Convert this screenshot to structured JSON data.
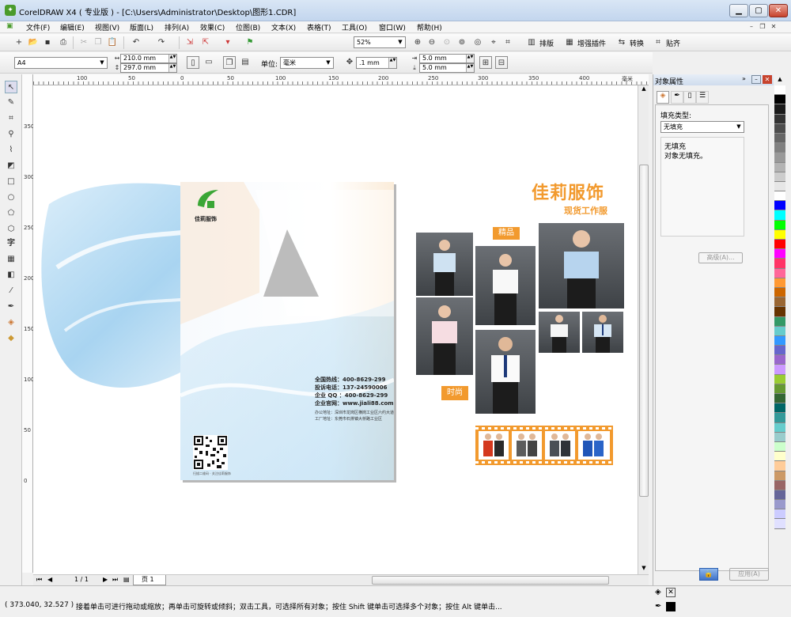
{
  "window": {
    "title": "CorelDRAW X4 ( 专业版 ) - [C:\\Users\\Administrator\\Desktop\\图形1.CDR]"
  },
  "menu": [
    "文件(F)",
    "编辑(E)",
    "视图(V)",
    "版面(L)",
    "排列(A)",
    "效果(C)",
    "位图(B)",
    "文本(X)",
    "表格(T)",
    "工具(O)",
    "窗口(W)",
    "帮助(H)"
  ],
  "toolbar": {
    "zoom": "52%",
    "layout_label": "排版",
    "plugin_label": "增强插件",
    "convert_label": "转换",
    "snap_label": "贴齐"
  },
  "propbar": {
    "page_size": "A4",
    "width": "210.0 mm",
    "height": "297.0 mm",
    "unit_label": "单位:",
    "unit": "毫米",
    "nudge": ".1 mm",
    "dup_x": "5.0 mm",
    "dup_y": "5.0 mm"
  },
  "rulers": {
    "h": [
      "100",
      "50",
      "0",
      "50",
      "100",
      "150",
      "200",
      "250",
      "300",
      "350",
      "400"
    ],
    "h_unit": "毫米",
    "v": [
      "350",
      "300",
      "250",
      "200",
      "150",
      "100",
      "50",
      "0"
    ]
  },
  "panel": {
    "title": "对象属性",
    "fill_type_label": "填充类型:",
    "fill_type": "无填充",
    "info_title": "无填充",
    "info_desc": "对象无填充。",
    "advanced": "高级(A)...",
    "apply": "应用(A)"
  },
  "page_nav": {
    "count": "1 / 1",
    "tab": "页 1"
  },
  "status": {
    "coords": "( 373.040, 32.527 )",
    "hint": "接着单击可进行拖动或缩放；再单击可旋转或倾斜；双击工具，可选择所有对象；按住 Shift 键单击可选择多个对象；按住 Alt 键单击..."
  },
  "design": {
    "brand_cn": "佳莉服饰",
    "subtitle": "现货工作服",
    "tag_jingpin": "精品",
    "tag_shishang": "时尚",
    "logo_text": "佳莉服饰",
    "contact": [
      "全国热线：400-8629-299",
      "投诉电话：137-24590006",
      "企业 QQ ：400-8629-299",
      "企业官网：www.jiali88.com"
    ],
    "addr": [
      "办公地址：深圳市龙岗区横岗工业区六约大道",
      "工厂地址：东莞市石排镇大桥路工业区"
    ],
    "qr_caption": "扫描二维码 · 关注佳莉服饰"
  },
  "palette": [
    "#ffffff",
    "#000000",
    "#1a1a1a",
    "#333333",
    "#4d4d4d",
    "#666666",
    "#808080",
    "#999999",
    "#b3b3b3",
    "#cccccc",
    "#e6e6e6",
    "#ffffff",
    "#0000ff",
    "#00ffff",
    "#00ff00",
    "#ffff00",
    "#ff0000",
    "#ff00ff",
    "#ff3366",
    "#ff6699",
    "#ff9933",
    "#cc6600",
    "#996633",
    "#663300",
    "#339966",
    "#66cccc",
    "#3399ff",
    "#6666cc",
    "#9966cc",
    "#cc99ff",
    "#99cc33",
    "#669933",
    "#336633",
    "#006666",
    "#339999",
    "#66cccc",
    "#99cccc",
    "#ccffcc",
    "#ffffcc",
    "#ffcc99",
    "#cc9966",
    "#996666",
    "#666699",
    "#9999cc",
    "#ccccff",
    "#e0e0ff"
  ],
  "colors": {
    "accent": "#f29a2e",
    "brand_green": "#3aa635"
  }
}
